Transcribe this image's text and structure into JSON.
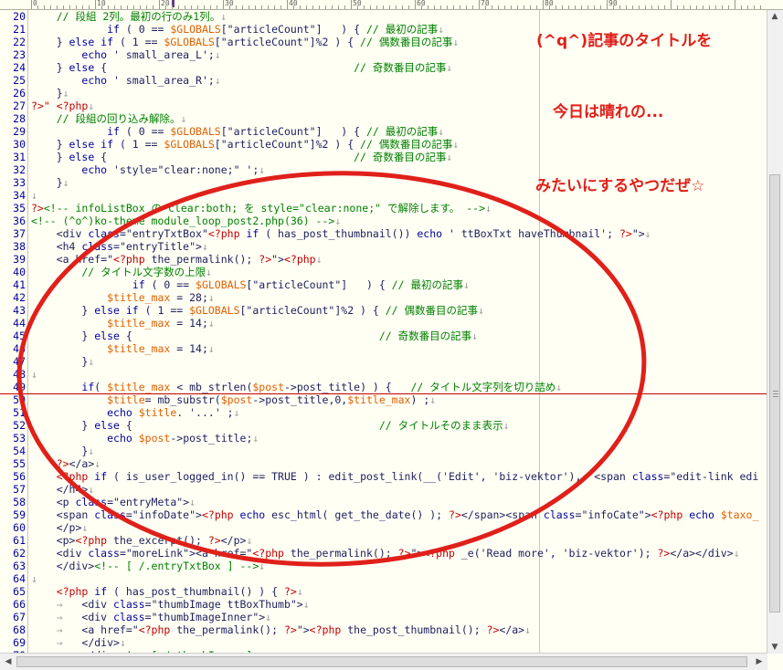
{
  "ruler": {
    "labels": [
      "0",
      "10",
      "20",
      "30",
      "40",
      "50",
      "60",
      "70",
      "80",
      "90"
    ]
  },
  "lines": [
    {
      "no": "20",
      "cur": false,
      "segs": [
        [
          "c",
          "    // 段組 2列。最初の行のみ1列。"
        ],
        [
          "m",
          "↓"
        ]
      ]
    },
    {
      "no": "21",
      "cur": false,
      "segs": [
        [
          "t",
          "            "
        ],
        [
          "k",
          "if"
        ],
        [
          "t",
          " ( 0 == "
        ],
        [
          "v",
          "$GLOBALS"
        ],
        [
          "t",
          "[\"articleCount\"]   ) { "
        ],
        [
          "c",
          "// 最初の記事"
        ],
        [
          "m",
          "↓"
        ]
      ]
    },
    {
      "no": "22",
      "cur": false,
      "segs": [
        [
          "t",
          "    } "
        ],
        [
          "k",
          "else if"
        ],
        [
          "t",
          " ( 1 == "
        ],
        [
          "v",
          "$GLOBALS"
        ],
        [
          "t",
          "[\"articleCount\"]%2 ) { "
        ],
        [
          "c",
          "// 偶数番目の記事"
        ],
        [
          "m",
          "↓"
        ]
      ]
    },
    {
      "no": "23",
      "cur": false,
      "segs": [
        [
          "t",
          "        "
        ],
        [
          "k",
          "echo"
        ],
        [
          "t",
          " ' small_area_L';"
        ],
        [
          "m",
          "↓"
        ]
      ]
    },
    {
      "no": "24",
      "cur": false,
      "segs": [
        [
          "t",
          "    } "
        ],
        [
          "k",
          "else"
        ],
        [
          "t",
          " {                                       "
        ],
        [
          "c",
          "// 奇数番目の記事"
        ],
        [
          "m",
          "↓"
        ]
      ]
    },
    {
      "no": "25",
      "cur": false,
      "segs": [
        [
          "t",
          "        "
        ],
        [
          "k",
          "echo"
        ],
        [
          "t",
          " ' small_area_R';"
        ],
        [
          "m",
          "↓"
        ]
      ]
    },
    {
      "no": "26",
      "cur": false,
      "segs": [
        [
          "t",
          "    }"
        ],
        [
          "m",
          "↓"
        ]
      ]
    },
    {
      "no": "27",
      "cur": false,
      "segs": [
        [
          "p",
          "?>\" <?php"
        ],
        [
          "m",
          "↓"
        ]
      ]
    },
    {
      "no": "28",
      "cur": false,
      "segs": [
        [
          "c",
          "    // 段組の回り込み解除。"
        ],
        [
          "m",
          "↓"
        ]
      ]
    },
    {
      "no": "29",
      "cur": false,
      "segs": [
        [
          "t",
          "            "
        ],
        [
          "k",
          "if"
        ],
        [
          "t",
          " ( 0 == "
        ],
        [
          "v",
          "$GLOBALS"
        ],
        [
          "t",
          "[\"articleCount\"]   ) { "
        ],
        [
          "c",
          "// 最初の記事"
        ],
        [
          "m",
          "↓"
        ]
      ]
    },
    {
      "no": "30",
      "cur": false,
      "segs": [
        [
          "t",
          "    } "
        ],
        [
          "k",
          "else if"
        ],
        [
          "t",
          " ( 1 == "
        ],
        [
          "v",
          "$GLOBALS"
        ],
        [
          "t",
          "[\"articleCount\"]%2 ) { "
        ],
        [
          "c",
          "// 偶数番目の記事"
        ],
        [
          "m",
          "↓"
        ]
      ]
    },
    {
      "no": "31",
      "cur": false,
      "segs": [
        [
          "t",
          "    } "
        ],
        [
          "k",
          "else"
        ],
        [
          "t",
          " {                                       "
        ],
        [
          "c",
          "// 奇数番目の記事"
        ],
        [
          "m",
          "↓"
        ]
      ]
    },
    {
      "no": "32",
      "cur": false,
      "segs": [
        [
          "t",
          "        "
        ],
        [
          "k",
          "echo"
        ],
        [
          "t",
          " 'style=\"clear:none;\" ';"
        ],
        [
          "m",
          "↓"
        ]
      ]
    },
    {
      "no": "33",
      "cur": false,
      "segs": [
        [
          "t",
          "    }"
        ],
        [
          "m",
          "↓"
        ]
      ]
    },
    {
      "no": "34",
      "cur": false,
      "segs": [
        [
          "m",
          "↓"
        ]
      ]
    },
    {
      "no": "35",
      "cur": false,
      "segs": [
        [
          "p",
          "?>"
        ],
        [
          "c",
          "<!-- infoListBox の clear:both; を style=\"clear:none;\" で解除します。 -->"
        ],
        [
          "m",
          "↓"
        ]
      ]
    },
    {
      "no": "36",
      "cur": false,
      "segs": [
        [
          "c",
          "<!-- (^o^)ko-theme module_loop_post2.php(36) -->"
        ],
        [
          "m",
          "↓"
        ]
      ]
    },
    {
      "no": "37",
      "cur": false,
      "segs": [
        [
          "t",
          "    <div "
        ],
        [
          "k",
          "class"
        ],
        [
          "t",
          "=\"entryTxtBox\""
        ],
        [
          "p",
          "<?php "
        ],
        [
          "k",
          "if"
        ],
        [
          "t",
          " ( has_post_thumbnail()) "
        ],
        [
          "k",
          "echo"
        ],
        [
          "t",
          " ' ttBoxTxt haveThumbnail'; "
        ],
        [
          "p",
          "?>"
        ],
        [
          "t",
          "\">"
        ],
        [
          "m",
          "↓"
        ]
      ]
    },
    {
      "no": "38",
      "cur": false,
      "segs": [
        [
          "t",
          "    <h4 "
        ],
        [
          "k",
          "class"
        ],
        [
          "t",
          "=\"entryTitle\">"
        ],
        [
          "m",
          "↓"
        ]
      ]
    },
    {
      "no": "39",
      "cur": false,
      "segs": [
        [
          "t",
          "    <a href=\""
        ],
        [
          "p",
          "<?php"
        ],
        [
          "t",
          " the_permalink(); "
        ],
        [
          "p",
          "?>"
        ],
        [
          "t",
          "\">"
        ],
        [
          "p",
          "<?php"
        ],
        [
          "m",
          "↓"
        ]
      ]
    },
    {
      "no": "40",
      "cur": false,
      "segs": [
        [
          "c",
          "        // タイトル文字数の上限"
        ],
        [
          "m",
          "↓"
        ]
      ]
    },
    {
      "no": "41",
      "cur": false,
      "segs": [
        [
          "t",
          "                "
        ],
        [
          "k",
          "if"
        ],
        [
          "t",
          " ( 0 == "
        ],
        [
          "v",
          "$GLOBALS"
        ],
        [
          "t",
          "[\"articleCount\"]   ) { "
        ],
        [
          "c",
          "// 最初の記事"
        ],
        [
          "m",
          "↓"
        ]
      ]
    },
    {
      "no": "42",
      "cur": false,
      "segs": [
        [
          "t",
          "            "
        ],
        [
          "v",
          "$title_max"
        ],
        [
          "t",
          " = 28;"
        ],
        [
          "m",
          "↓"
        ]
      ]
    },
    {
      "no": "43",
      "cur": false,
      "segs": [
        [
          "t",
          "        } "
        ],
        [
          "k",
          "else if"
        ],
        [
          "t",
          " ( 1 == "
        ],
        [
          "v",
          "$GLOBALS"
        ],
        [
          "t",
          "[\"articleCount\"]%2 ) { "
        ],
        [
          "c",
          "// 偶数番目の記事"
        ],
        [
          "m",
          "↓"
        ]
      ]
    },
    {
      "no": "44",
      "cur": false,
      "segs": [
        [
          "t",
          "            "
        ],
        [
          "v",
          "$title_max"
        ],
        [
          "t",
          " = 14;"
        ],
        [
          "m",
          "↓"
        ]
      ]
    },
    {
      "no": "45",
      "cur": false,
      "segs": [
        [
          "t",
          "        } "
        ],
        [
          "k",
          "else"
        ],
        [
          "t",
          " {                                       "
        ],
        [
          "c",
          "// 奇数番目の記事"
        ],
        [
          "m",
          "↓"
        ]
      ]
    },
    {
      "no": "46",
      "cur": false,
      "segs": [
        [
          "t",
          "            "
        ],
        [
          "v",
          "$title_max"
        ],
        [
          "t",
          " = 14;"
        ],
        [
          "m",
          "↓"
        ]
      ]
    },
    {
      "no": "47",
      "cur": false,
      "segs": [
        [
          "t",
          "        }"
        ],
        [
          "m",
          "↓"
        ]
      ]
    },
    {
      "no": "48",
      "cur": false,
      "segs": [
        [
          "m",
          "↓"
        ]
      ]
    },
    {
      "no": "49",
      "cur": true,
      "segs": [
        [
          "t",
          "        "
        ],
        [
          "k",
          "if"
        ],
        [
          "t",
          "( "
        ],
        [
          "v",
          "$title_max"
        ],
        [
          "t",
          " < mb_strlen("
        ],
        [
          "v",
          "$post"
        ],
        [
          "t",
          "->post_title) ) {   "
        ],
        [
          "c",
          "// タイトル文字列を切り詰め"
        ],
        [
          "m",
          "↓"
        ]
      ]
    },
    {
      "no": "50",
      "cur": false,
      "segs": [
        [
          "t",
          "            "
        ],
        [
          "v",
          "$title"
        ],
        [
          "t",
          "= mb_substr("
        ],
        [
          "v",
          "$post"
        ],
        [
          "t",
          "->post_title,0,"
        ],
        [
          "v",
          "$title_max"
        ],
        [
          "t",
          ") ;"
        ],
        [
          "m",
          "↓"
        ]
      ]
    },
    {
      "no": "51",
      "cur": false,
      "segs": [
        [
          "t",
          "            "
        ],
        [
          "k",
          "echo"
        ],
        [
          "t",
          " "
        ],
        [
          "v",
          "$title"
        ],
        [
          "t",
          ". '...' ;"
        ],
        [
          "m",
          "↓"
        ]
      ]
    },
    {
      "no": "52",
      "cur": false,
      "segs": [
        [
          "t",
          "        } "
        ],
        [
          "k",
          "else"
        ],
        [
          "t",
          " {                                       "
        ],
        [
          "c",
          "// タイトルそのまま表示"
        ],
        [
          "m",
          "↓"
        ]
      ]
    },
    {
      "no": "53",
      "cur": false,
      "segs": [
        [
          "t",
          "            "
        ],
        [
          "k",
          "echo"
        ],
        [
          "t",
          " "
        ],
        [
          "v",
          "$post"
        ],
        [
          "t",
          "->post_title;"
        ],
        [
          "m",
          "↓"
        ]
      ]
    },
    {
      "no": "54",
      "cur": false,
      "segs": [
        [
          "t",
          "        }"
        ],
        [
          "m",
          "↓"
        ]
      ]
    },
    {
      "no": "55",
      "cur": false,
      "segs": [
        [
          "t",
          "    "
        ],
        [
          "p",
          "?>"
        ],
        [
          "t",
          "</a>"
        ],
        [
          "m",
          "↓"
        ]
      ]
    },
    {
      "no": "56",
      "cur": false,
      "segs": [
        [
          "t",
          "    "
        ],
        [
          "p",
          "<?php"
        ],
        [
          "t",
          " "
        ],
        [
          "k",
          "if"
        ],
        [
          "t",
          " ( is_user_logged_in() == TRUE ) : edit_post_link(__('Edit', 'biz-vektor'), '<span "
        ],
        [
          "k",
          "class"
        ],
        [
          "t",
          "=\"edit-link edi"
        ]
      ]
    },
    {
      "no": "57",
      "cur": false,
      "segs": [
        [
          "t",
          "    </h4>"
        ],
        [
          "m",
          "↓"
        ]
      ]
    },
    {
      "no": "58",
      "cur": false,
      "segs": [
        [
          "t",
          "    <p "
        ],
        [
          "k",
          "class"
        ],
        [
          "t",
          "=\"entryMeta\">"
        ],
        [
          "m",
          "↓"
        ]
      ]
    },
    {
      "no": "59",
      "cur": false,
      "segs": [
        [
          "t",
          "    <span "
        ],
        [
          "k",
          "class"
        ],
        [
          "t",
          "=\"infoDate\">"
        ],
        [
          "p",
          "<?php"
        ],
        [
          "t",
          " "
        ],
        [
          "k",
          "echo"
        ],
        [
          "t",
          " esc_html( get_the_date() ); "
        ],
        [
          "p",
          "?>"
        ],
        [
          "t",
          "</span><span "
        ],
        [
          "k",
          "class"
        ],
        [
          "t",
          "=\"infoCate\">"
        ],
        [
          "p",
          "<?php"
        ],
        [
          "t",
          " "
        ],
        [
          "k",
          "echo"
        ],
        [
          "t",
          " "
        ],
        [
          "v",
          "$taxo_"
        ]
      ]
    },
    {
      "no": "60",
      "cur": false,
      "segs": [
        [
          "t",
          "    </p>"
        ],
        [
          "m",
          "↓"
        ]
      ]
    },
    {
      "no": "61",
      "cur": false,
      "segs": [
        [
          "t",
          "    <p>"
        ],
        [
          "p",
          "<?php"
        ],
        [
          "t",
          " the_excerpt(); "
        ],
        [
          "p",
          "?>"
        ],
        [
          "t",
          "</p>"
        ],
        [
          "m",
          "↓"
        ]
      ]
    },
    {
      "no": "62",
      "cur": false,
      "segs": [
        [
          "t",
          "    <div "
        ],
        [
          "k",
          "class"
        ],
        [
          "t",
          "=\"moreLink\"><a href=\""
        ],
        [
          "p",
          "<?php"
        ],
        [
          "t",
          " the_permalink(); "
        ],
        [
          "p",
          "?>"
        ],
        [
          "t",
          "\">"
        ],
        [
          "p",
          "<?php"
        ],
        [
          "t",
          " _e('Read more', 'biz-vektor'); "
        ],
        [
          "p",
          "?>"
        ],
        [
          "t",
          "</a></div>"
        ],
        [
          "m",
          "↓"
        ]
      ]
    },
    {
      "no": "63",
      "cur": false,
      "segs": [
        [
          "t",
          "    </div>"
        ],
        [
          "c",
          "<!-- [ /.entryTxtBox ] -->"
        ],
        [
          "m",
          "↓"
        ]
      ]
    },
    {
      "no": "64",
      "cur": false,
      "segs": [
        [
          "m",
          "↓"
        ]
      ]
    },
    {
      "no": "65",
      "cur": false,
      "segs": [
        [
          "t",
          "    "
        ],
        [
          "p",
          "<?php"
        ],
        [
          "t",
          " "
        ],
        [
          "k",
          "if"
        ],
        [
          "t",
          " ( has_post_thumbnail() ) { "
        ],
        [
          "p",
          "?>"
        ],
        [
          "m",
          "↓"
        ]
      ]
    },
    {
      "no": "66",
      "cur": false,
      "segs": [
        [
          "m",
          "    →   "
        ],
        [
          "t",
          "<div "
        ],
        [
          "k",
          "class"
        ],
        [
          "t",
          "=\"thumbImage ttBoxThumb\">"
        ],
        [
          "m",
          "↓"
        ]
      ]
    },
    {
      "no": "67",
      "cur": false,
      "segs": [
        [
          "m",
          "    →   "
        ],
        [
          "t",
          "<div "
        ],
        [
          "k",
          "class"
        ],
        [
          "t",
          "=\"thumbImageInner\">"
        ],
        [
          "m",
          "↓"
        ]
      ]
    },
    {
      "no": "68",
      "cur": false,
      "segs": [
        [
          "m",
          "    →   "
        ],
        [
          "t",
          "<a href=\""
        ],
        [
          "p",
          "<?php"
        ],
        [
          "t",
          " the_permalink(); "
        ],
        [
          "p",
          "?>"
        ],
        [
          "t",
          "\">"
        ],
        [
          "p",
          "<?php"
        ],
        [
          "t",
          " the_post_thumbnail(); "
        ],
        [
          "p",
          "?>"
        ],
        [
          "t",
          "</a>"
        ],
        [
          "m",
          "↓"
        ]
      ]
    },
    {
      "no": "69",
      "cur": false,
      "segs": [
        [
          "m",
          "    →   "
        ],
        [
          "t",
          "</div>"
        ],
        [
          "m",
          "↓"
        ]
      ]
    },
    {
      "no": "70",
      "cur": false,
      "segs": [
        [
          "m",
          "    →   "
        ],
        [
          "t",
          "</div>"
        ],
        [
          "c",
          "<!-- [ /.thumbImage ] -->"
        ],
        [
          "m",
          "↓"
        ]
      ]
    }
  ],
  "annotations": {
    "line1": "(^q^)記事のタイトルを",
    "line2": "今日は晴れの...",
    "line3": "みたいにするやつだぜ☆"
  },
  "colors": {
    "annotation": "#e0201a",
    "circle": "#e0201a",
    "background": "#fffff4"
  }
}
